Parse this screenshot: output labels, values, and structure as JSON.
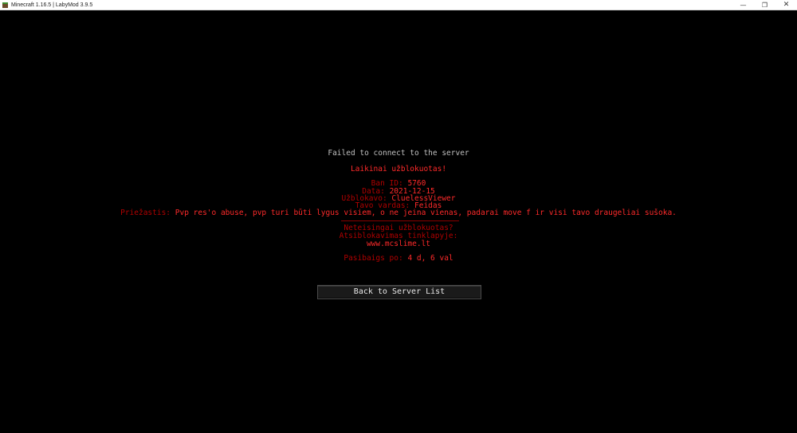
{
  "window": {
    "title": "Minecraft 1.16.5 | LabyMod 3.9.5",
    "app_icon": "minecraft-icon",
    "controls": {
      "minimize": "—",
      "restore": "❐",
      "close": "✕"
    }
  },
  "disconnect": {
    "heading": "Failed to connect to the server",
    "banned_title": "Laikinai užblokuotas!",
    "ban_id_label": "Ban ID:",
    "ban_id_value": "5760",
    "date_label": "Data:",
    "date_value": "2021-12-15",
    "banned_by_label": "Užblokavo:",
    "banned_by_value": "CluelessViewer",
    "name_label": "Tavo vardas:",
    "name_value": "Feidas",
    "reason_label": "Priežastis:",
    "reason_value": "Pvp res'o abuse, pvp turi būti lygus visiem, o ne jeina vienas, padarai move f ir visi tavo draugeliai sušoka.",
    "appeal_question": "Neteisingai užblokuotas?",
    "appeal_text": "Atsiblokavimas tinklapyje:",
    "appeal_url": "www.mcslime.lt",
    "expires_label": "Pasibaigs po:",
    "expires_value": "4 d, 6 val",
    "back_button": "Back to Server List"
  },
  "colors": {
    "background": "#000000",
    "label_red": "#b00000",
    "value_red": "#ff2a2a",
    "heading_gray": "#c0c0c0"
  }
}
